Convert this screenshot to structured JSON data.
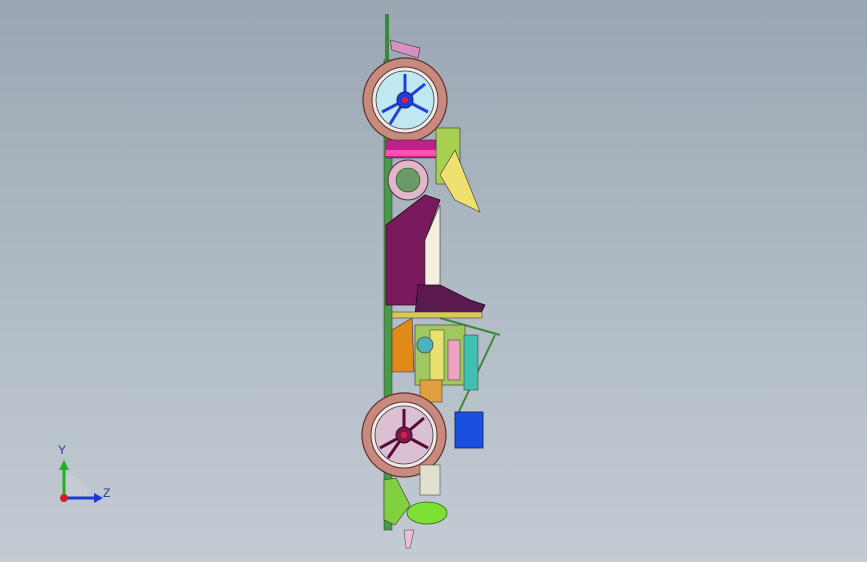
{
  "viewport": {
    "background_top": "#9aa6b2",
    "background_bottom": "#c3cbd3"
  },
  "model": {
    "description_icon": "race-car-assembly-side-view",
    "colors": {
      "tire": "#c98a7e",
      "rim_blue": "#1f3fd8",
      "chassis_purple": "#7a1a5e",
      "frame_green": "#3a8a3a",
      "seat_purple": "#5a1a50",
      "pink": "#e0469a",
      "yellow": "#e8e070",
      "orange": "#e08a18",
      "blue_box": "#1a50e0",
      "lime": "#7ee032",
      "cyan": "#30b0c0"
    }
  },
  "triad": {
    "y_label": "Y",
    "z_label": "Z",
    "y_color": "#20b020",
    "z_color": "#1a3ad0",
    "origin_color": "#d02020"
  }
}
